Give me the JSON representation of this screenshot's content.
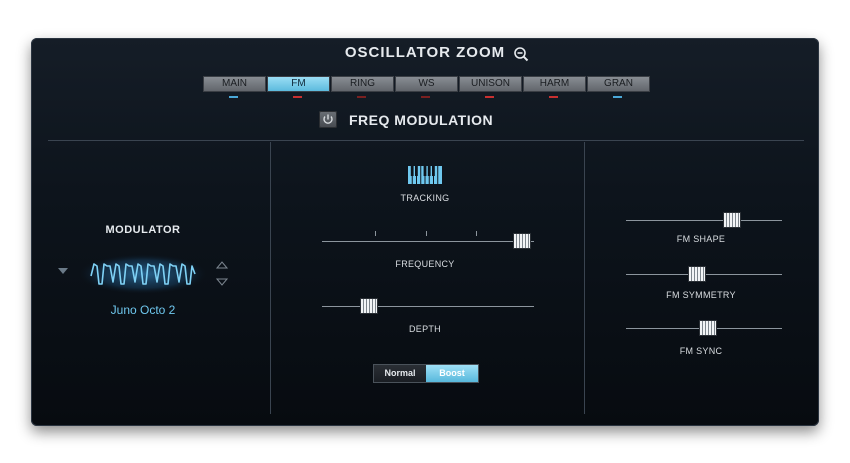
{
  "header": {
    "title": "OSCILLATOR ZOOM",
    "zoom_icon": "zoom-out-icon"
  },
  "tabs": [
    {
      "label": "MAIN",
      "active": false,
      "indicator": "#4aa8d8"
    },
    {
      "label": "FM",
      "active": true,
      "indicator": "#c83030"
    },
    {
      "label": "RING",
      "active": false,
      "indicator": "#c83030"
    },
    {
      "label": "WS",
      "active": false,
      "indicator": "#c83030"
    },
    {
      "label": "UNISON",
      "active": false,
      "indicator": "#c83030"
    },
    {
      "label": "HARM",
      "active": false,
      "indicator": "#c83030"
    },
    {
      "label": "GRAN",
      "active": false,
      "indicator": "#4aa8d8"
    }
  ],
  "section": {
    "title": "FREQ MODULATION",
    "power_icon": "power-icon"
  },
  "modulator": {
    "title": "MODULATOR",
    "patch": "Juno Octo 2"
  },
  "center": {
    "tracking_label": "TRACKING",
    "frequency_label": "FREQUENCY",
    "frequency_value": 0.98,
    "depth_label": "DEPTH",
    "depth_value": 0.2,
    "mode_normal": "Normal",
    "mode_boost": "Boost",
    "mode_selected": "Boost"
  },
  "right": {
    "fm_shape_label": "FM SHAPE",
    "fm_shape_value": 0.7,
    "fm_symmetry_label": "FM SYMMETRY",
    "fm_symmetry_value": 0.45,
    "fm_sync_label": "FM SYNC",
    "fm_sync_value": 0.53
  },
  "colors": {
    "accent": "#6fc8ef",
    "panel": "#0d141c"
  }
}
